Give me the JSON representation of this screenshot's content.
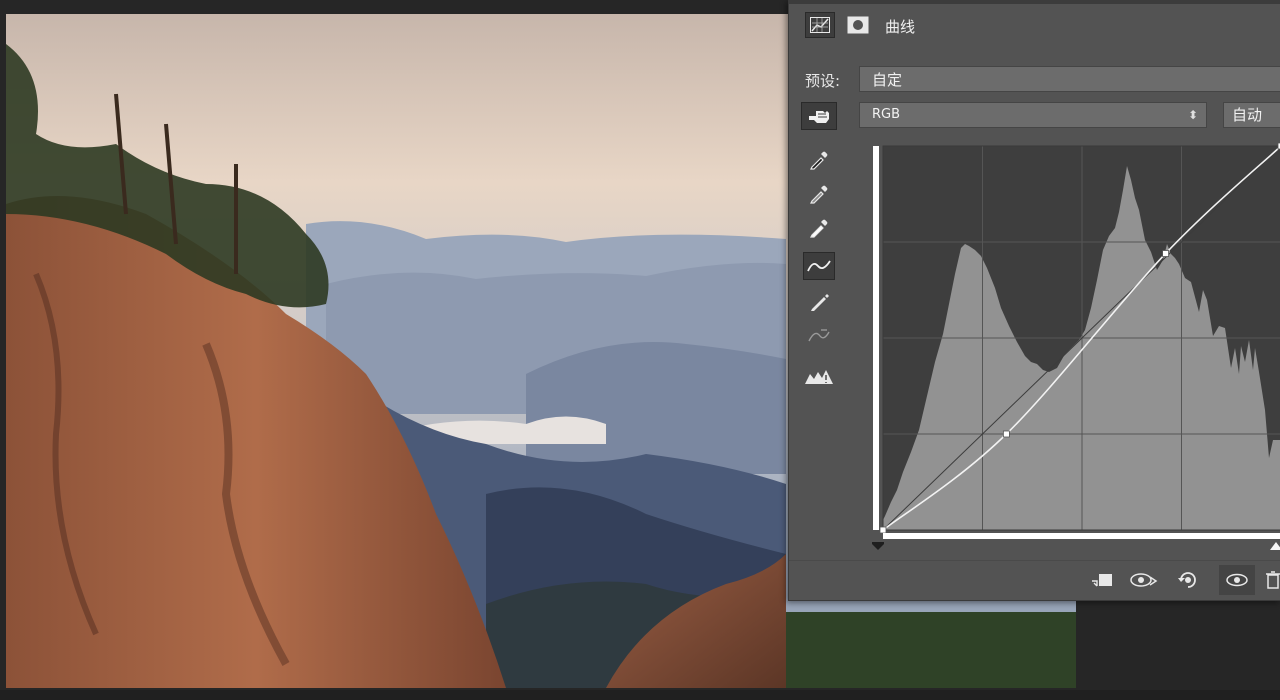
{
  "panel": {
    "title": "曲线",
    "preset_label": "预设:",
    "preset_value": "自定",
    "channel_value": "RGB",
    "auto_label": "自动"
  },
  "colors": {
    "panel_bg": "#535353",
    "graph_bg": "#929292",
    "histogram": "#3e3e3e",
    "curve": "#f2f2f2"
  },
  "curve": {
    "points": [
      [
        0,
        0
      ],
      [
        0.31,
        0.25
      ],
      [
        0.71,
        0.72
      ],
      [
        1,
        1
      ]
    ],
    "input_black": 0,
    "input_white": 1
  },
  "icons": {
    "adjustment": "curves-adjustment-icon",
    "mask": "layer-mask-icon",
    "on_image": "hand-pointer-icon",
    "sample_black": "eyedropper-black-icon",
    "sample_gray": "eyedropper-gray-icon",
    "sample_white": "eyedropper-white-icon",
    "curve_tool": "curve-tool-icon",
    "pencil": "pencil-icon",
    "smooth": "smooth-curve-icon",
    "clipping": "clipping-warning-icon",
    "clip_to_layer": "clip-to-layer-icon",
    "view_previous": "view-previous-icon",
    "reset": "reset-icon",
    "visibility": "visibility-icon",
    "delete": "trash-icon"
  }
}
